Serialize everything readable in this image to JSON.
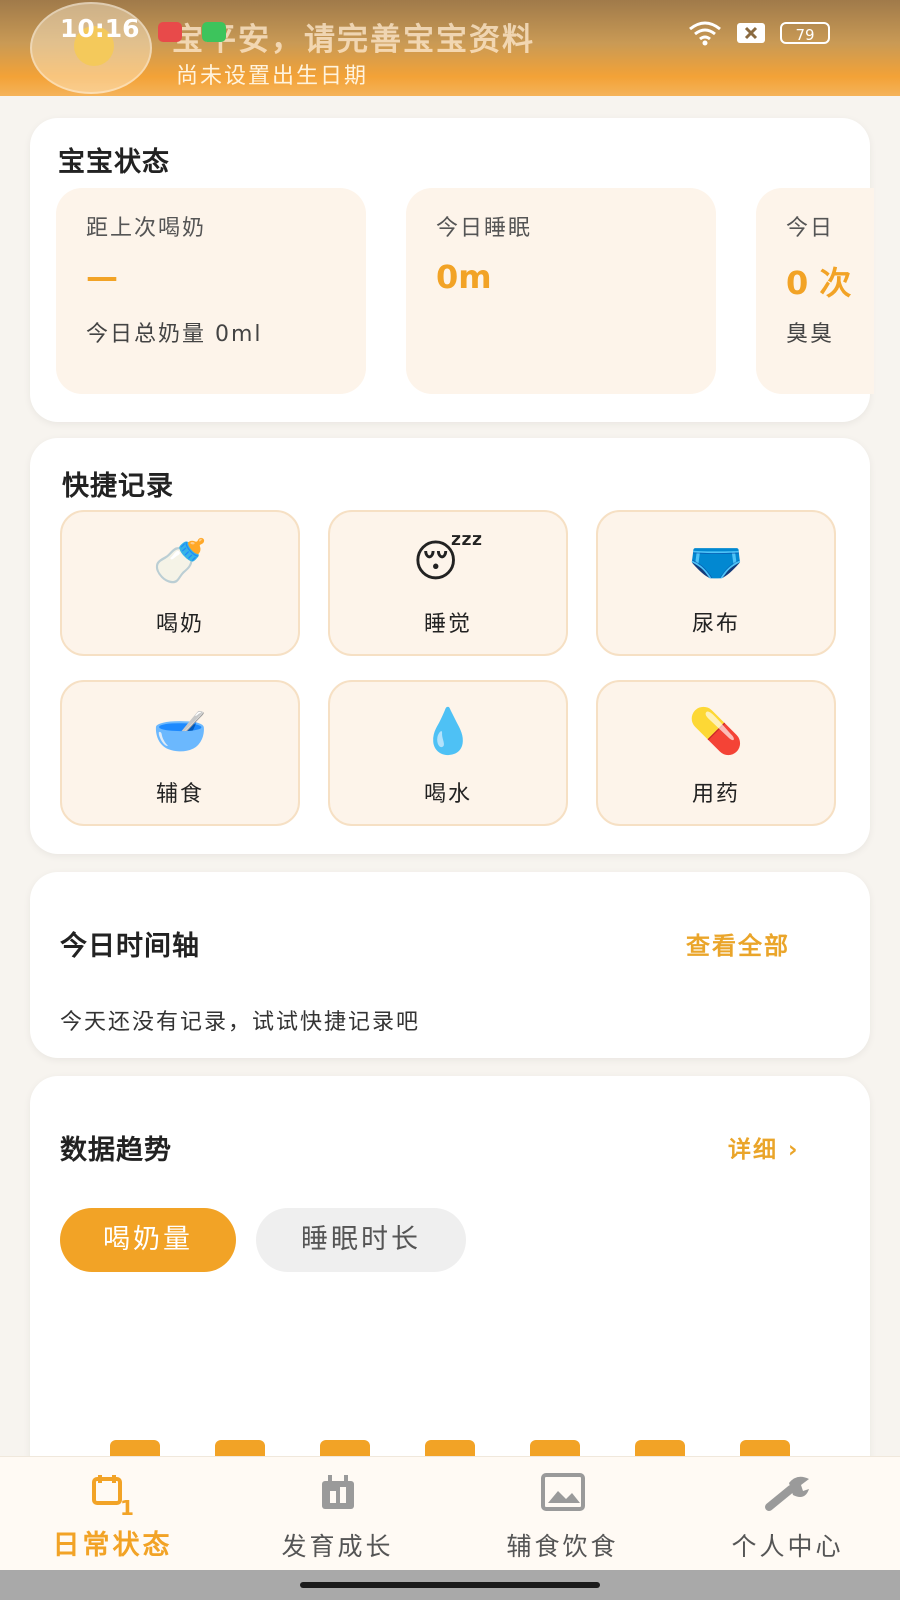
{
  "status_bar": {
    "time": "10:16",
    "battery": "79"
  },
  "header": {
    "greeting": "宝平安，请完善宝宝资料",
    "subtitle": "尚未设置出生日期"
  },
  "baby_status": {
    "title": "宝宝状态",
    "cards": [
      {
        "label": "距上次喝奶",
        "value": "—",
        "sub": "今日总奶量 0ml"
      },
      {
        "label": "今日睡眠",
        "value": "0m",
        "sub": ""
      },
      {
        "label": "今日",
        "value": "0 次",
        "sub": "臭臭"
      }
    ]
  },
  "quick_record": {
    "title": "快捷记录",
    "items": [
      {
        "label": "喝奶",
        "icon": "baby-bottle-icon",
        "glyph": "🍼"
      },
      {
        "label": "睡觉",
        "icon": "sleeping-face-icon",
        "glyph": "😴"
      },
      {
        "label": "尿布",
        "icon": "diaper-icon",
        "glyph": "🩲"
      },
      {
        "label": "辅食",
        "icon": "bowl-spoon-icon",
        "glyph": "🥣"
      },
      {
        "label": "喝水",
        "icon": "water-drop-icon",
        "glyph": "💧"
      },
      {
        "label": "用药",
        "icon": "pill-icon",
        "glyph": "💊"
      }
    ]
  },
  "timeline": {
    "title": "今日时间轴",
    "view_all": "查看全部",
    "empty_text": "今天还没有记录，试试快捷记录吧"
  },
  "trends": {
    "title": "数据趋势",
    "detail": "详细 ›",
    "tabs": [
      {
        "label": "喝奶量",
        "active": true
      },
      {
        "label": "睡眠时长",
        "active": false
      }
    ]
  },
  "bottom_nav": [
    {
      "label": "日常状态",
      "icon": "daily-calendar-icon",
      "active": true
    },
    {
      "label": "发育成长",
      "icon": "growth-chart-icon",
      "active": false
    },
    {
      "label": "辅食饮食",
      "icon": "image-icon",
      "active": false
    },
    {
      "label": "个人中心",
      "icon": "wrench-icon",
      "active": false
    }
  ],
  "colors": {
    "accent": "#f2a326",
    "card_bg": "#fdf4ea",
    "page_bg": "#f7f4ef"
  }
}
